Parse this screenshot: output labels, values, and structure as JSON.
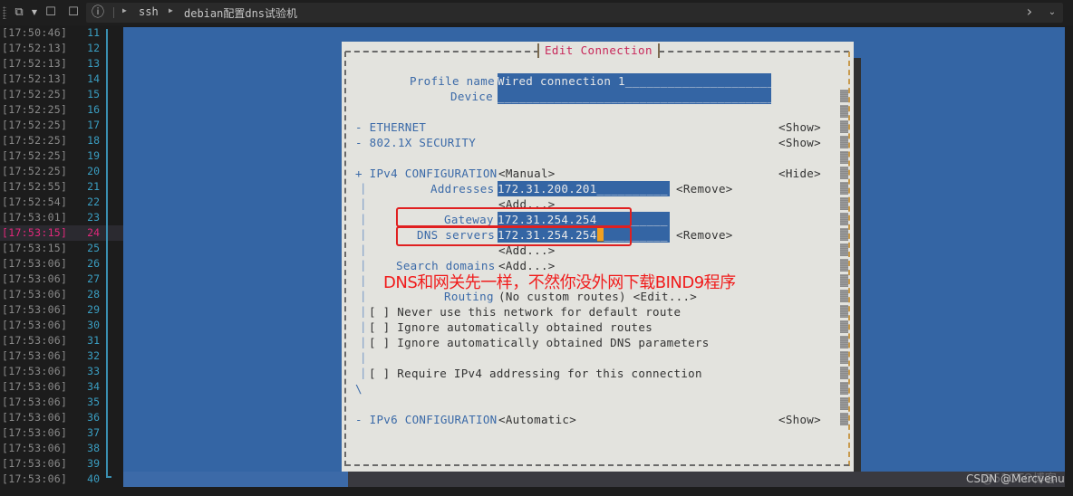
{
  "toolbar": {
    "icons": [
      "new-tab-icon",
      "dropdown-icon",
      "close-tab-icon",
      "duplicate-tab-icon",
      "info-icon"
    ],
    "breadcrumb": [
      "ssh",
      "debian配置dns试验机"
    ],
    "nav": [
      "chevron-right-icon",
      "chevron-down-icon"
    ]
  },
  "gutter": {
    "highlight_line": 24,
    "lines": [
      {
        "ts": "[17:50:46]",
        "ln": "11"
      },
      {
        "ts": "[17:52:13]",
        "ln": "12"
      },
      {
        "ts": "[17:52:13]",
        "ln": "13"
      },
      {
        "ts": "[17:52:13]",
        "ln": "14"
      },
      {
        "ts": "[17:52:25]",
        "ln": "15"
      },
      {
        "ts": "[17:52:25]",
        "ln": "16"
      },
      {
        "ts": "[17:52:25]",
        "ln": "17"
      },
      {
        "ts": "[17:52:25]",
        "ln": "18"
      },
      {
        "ts": "[17:52:25]",
        "ln": "19"
      },
      {
        "ts": "[17:52:25]",
        "ln": "20"
      },
      {
        "ts": "[17:52:55]",
        "ln": "21"
      },
      {
        "ts": "[17:52:54]",
        "ln": "22"
      },
      {
        "ts": "[17:53:01]",
        "ln": "23"
      },
      {
        "ts": "[17:53:15]",
        "ln": "24"
      },
      {
        "ts": "[17:53:15]",
        "ln": "25"
      },
      {
        "ts": "[17:53:06]",
        "ln": "26"
      },
      {
        "ts": "[17:53:06]",
        "ln": "27"
      },
      {
        "ts": "[17:53:06]",
        "ln": "28"
      },
      {
        "ts": "[17:53:06]",
        "ln": "29"
      },
      {
        "ts": "[17:53:06]",
        "ln": "30"
      },
      {
        "ts": "[17:53:06]",
        "ln": "31"
      },
      {
        "ts": "[17:53:06]",
        "ln": "32"
      },
      {
        "ts": "[17:53:06]",
        "ln": "33"
      },
      {
        "ts": "[17:53:06]",
        "ln": "34"
      },
      {
        "ts": "[17:53:06]",
        "ln": "35"
      },
      {
        "ts": "[17:53:06]",
        "ln": "36"
      },
      {
        "ts": "[17:53:06]",
        "ln": "37"
      },
      {
        "ts": "[17:53:06]",
        "ln": "38"
      },
      {
        "ts": "[17:53:06]",
        "ln": "39"
      },
      {
        "ts": "[17:53:06]",
        "ln": "40"
      }
    ]
  },
  "dialog": {
    "title": "Edit Connection",
    "profile_name_label": "Profile name",
    "profile_name_value": "Wired connection 1______________________",
    "device_label": "Device",
    "device_value": "________________________________________",
    "ethernet": "- ETHERNET",
    "security": "- 802.1X SECURITY",
    "show": "<Show>",
    "hide": "<Hide>",
    "ipv4_label": "+ IPv4 CONFIGURATION",
    "ipv4_mode": "<Manual>",
    "addresses_label": "Addresses",
    "addresses_value": "172.31.200.201__________",
    "remove": "<Remove>",
    "add": "<Add...>",
    "gateway_label": "Gateway",
    "gateway_value": "172.31.254.254__________",
    "dns_label": "DNS servers",
    "dns_value": "172.31.254.254",
    "dns_cursor": "_",
    "dns_pad": "_________",
    "search_domains_label": "Search domains",
    "routing_label": "Routing",
    "routing_value": "(No custom routes) <Edit...>",
    "checkboxes": [
      "[ ] Never use this network for default route",
      "[ ] Ignore automatically obtained routes",
      "[ ] Ignore automatically obtained DNS parameters",
      "[ ] Require IPv4 addressing for this connection"
    ],
    "section_end": "\\",
    "ipv6_label": "- IPv6 CONFIGURATION",
    "ipv6_mode": "<Automatic>"
  },
  "annotation": "DNS和网关先一样，不然你没外网下载BIND9程序",
  "watermark": "CSDN @Mercvenu",
  "watermark_faint": "@51CTO博客",
  "colors": {
    "terminal_bg": "#3465a4",
    "dialog_bg": "#e3e3de",
    "title": "#c8285a",
    "label": "#3b6aa8",
    "annotation": "#f01c1c",
    "line_number": "#3a9ec2",
    "highlight": "#e0287a"
  }
}
